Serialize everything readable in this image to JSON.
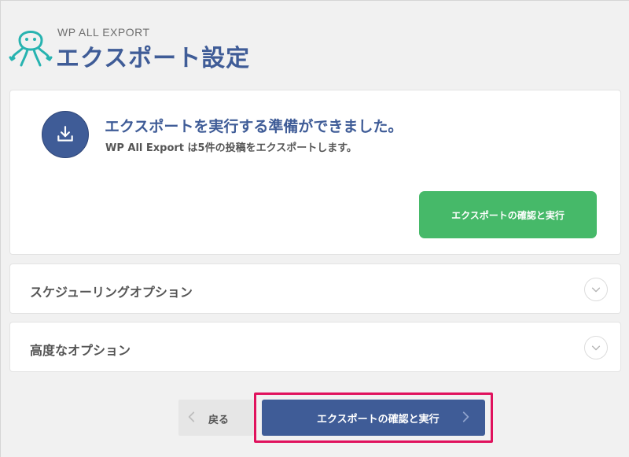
{
  "header": {
    "brand": "WP ALL EXPORT",
    "title": "エクスポート設定",
    "logo_icon": "octopus-logo-icon"
  },
  "ready_card": {
    "icon": "download-icon",
    "title": "エクスポートを実行する準備ができました。",
    "subtitle": "WP All Export は5件の投稿をエクスポートします。",
    "confirm_button": "エクスポートの確認と実行"
  },
  "accordions": [
    {
      "label": "スケジューリングオプション",
      "icon": "chevron-down-icon"
    },
    {
      "label": "高度なオプション",
      "icon": "chevron-down-icon"
    }
  ],
  "footer_nav": {
    "back_label": "戻る",
    "run_label": "エクスポートの確認と実行",
    "highlight_color": "#e0125d"
  },
  "colors": {
    "brand_blue": "#3f5c97",
    "teal": "#27b3b0",
    "green": "#46b969"
  }
}
